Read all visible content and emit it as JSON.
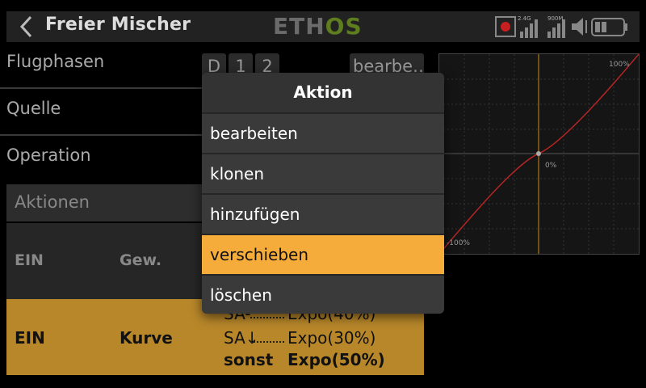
{
  "header": {
    "title": "Freier Mischer",
    "logo_left": "ETH",
    "logo_right": "OS",
    "signal_1_label": "2.4G",
    "signal_2_label": "900M"
  },
  "rows": {
    "flugphasen": "Flugphasen",
    "quelle": "Quelle",
    "operation": "Operation"
  },
  "flugphasen_buttons": [
    "D",
    "1",
    "2"
  ],
  "edit_button": "bearbe…",
  "actions": {
    "header": "Aktionen",
    "col_state": "EIN",
    "col_weight": "Gew.",
    "row": {
      "state": "EIN",
      "weight": "Kurve",
      "conditions": [
        {
          "switch": "SA-",
          "value": "Expo(40%)"
        },
        {
          "switch": "SA↓",
          "value": "Expo(30%)"
        },
        {
          "switch": "sonst",
          "value": "Expo(50%)"
        }
      ]
    }
  },
  "curve": {
    "label_top": "100%",
    "label_mid": "0%",
    "label_bottom": "-100%"
  },
  "modal": {
    "title": "Aktion",
    "items": [
      "bearbeiten",
      "klonen",
      "hinzufügen",
      "verschieben",
      "löschen"
    ],
    "selected_index": 3
  },
  "colors": {
    "accent": "#f6ac3a",
    "row_highlight": "#b8872a",
    "curve_line": "#b52525",
    "axis_line": "#c88a1a"
  }
}
